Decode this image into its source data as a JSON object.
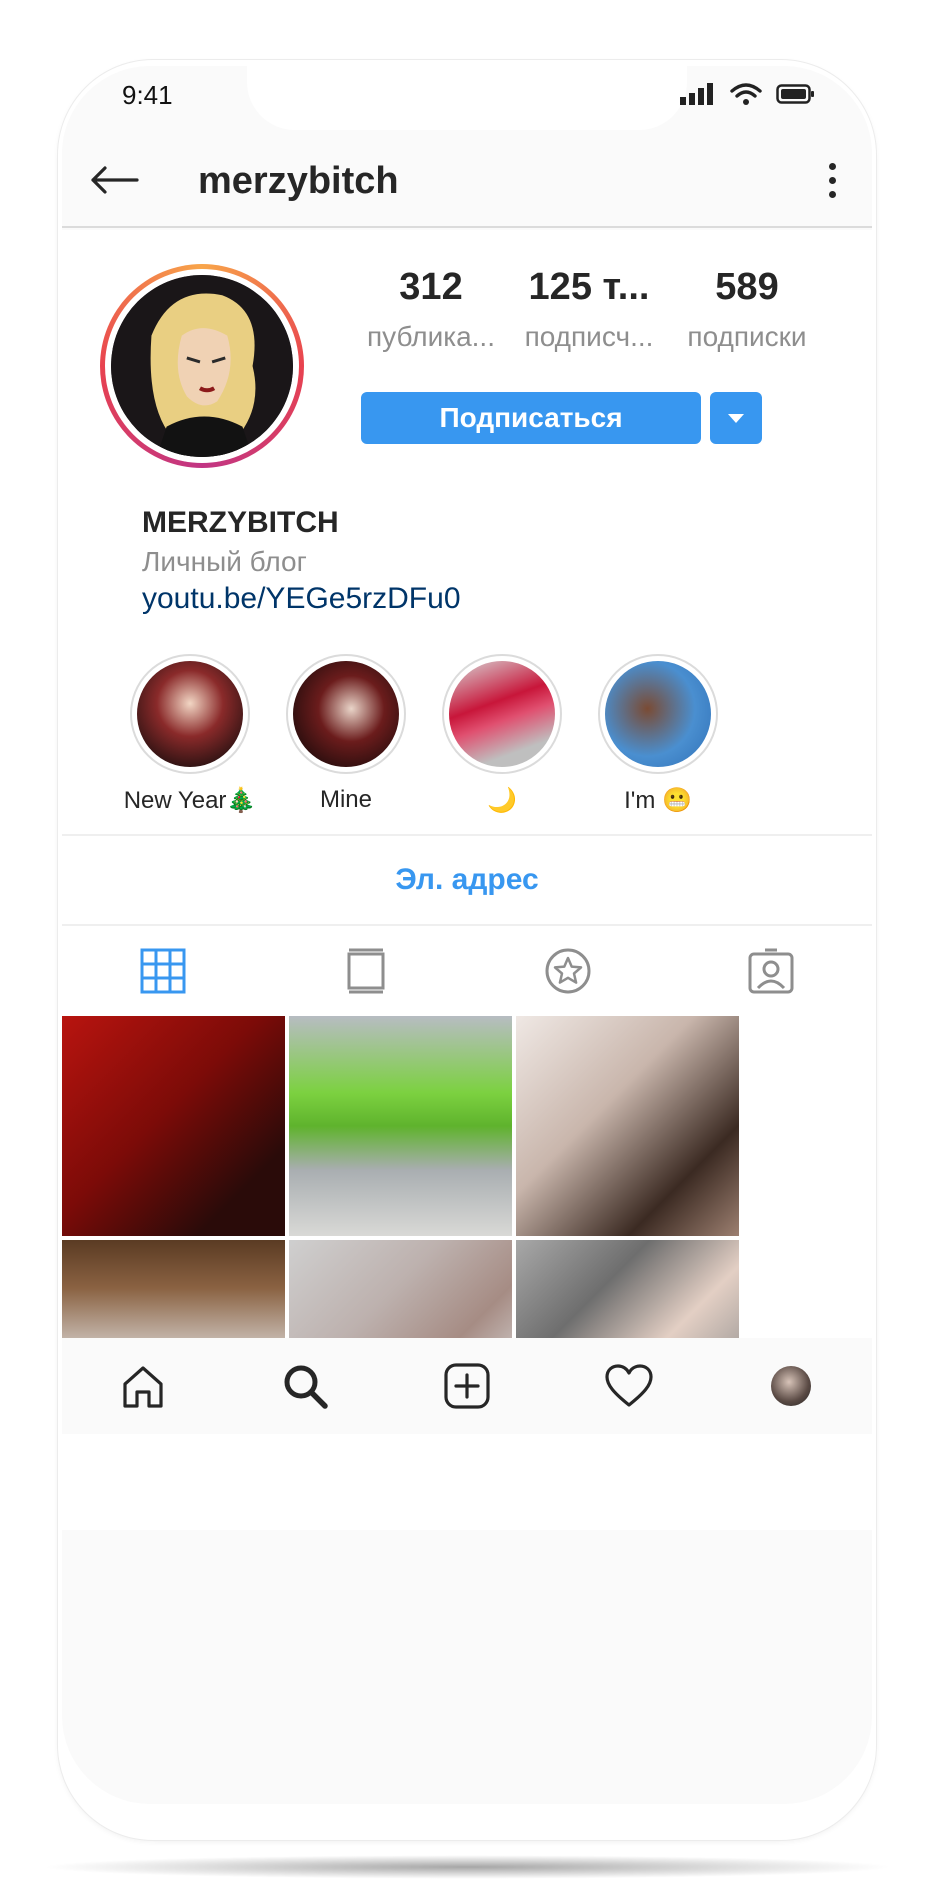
{
  "status_bar": {
    "time": "9:41"
  },
  "header": {
    "title": "merzybitch"
  },
  "profile": {
    "stats": [
      {
        "num": "312",
        "label": "публика..."
      },
      {
        "num": "125 т...",
        "label": "подписч..."
      },
      {
        "num": "589",
        "label": "подписки"
      }
    ],
    "follow_label": "Подписаться",
    "name": "MERZYBITCH",
    "category": "Личный блог",
    "link": "youtu.be/YEGe5rzDFu0"
  },
  "highlights": [
    {
      "label": "New Year🎄"
    },
    {
      "label": "Mine"
    },
    {
      "label": "🌙"
    },
    {
      "label": "I'm 😬"
    }
  ],
  "email_label": "Эл. адрес",
  "tabs": [
    "grid-icon",
    "igtv-icon",
    "star-icon",
    "tagged-icon"
  ],
  "bottom_nav": [
    "home-icon",
    "search-icon",
    "add-icon",
    "heart-icon",
    "profile-avatar"
  ],
  "colors": {
    "accent": "#3897f0",
    "link": "#003569",
    "muted": "#8e8e8e"
  }
}
